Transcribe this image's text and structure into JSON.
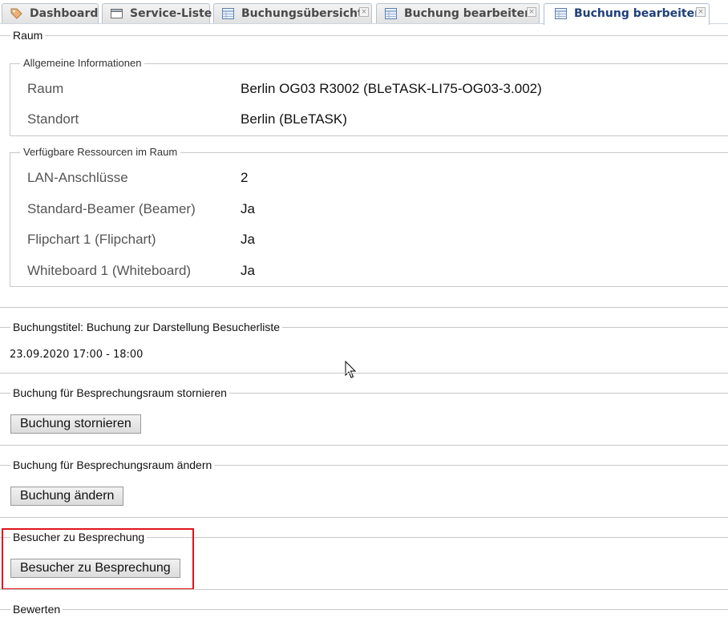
{
  "tabs": [
    {
      "label": "Dashboard",
      "icon": "tag-icon",
      "closable": false,
      "active": false
    },
    {
      "label": "Service-Liste",
      "icon": "window-icon",
      "closable": false,
      "active": false
    },
    {
      "label": "Buchungsübersicht",
      "icon": "table-icon",
      "closable": true,
      "active": false
    },
    {
      "label": "Buchung bearbeiten",
      "icon": "table-icon",
      "closable": true,
      "active": false
    },
    {
      "label": "Buchung bearbeiten",
      "icon": "table-icon",
      "closable": true,
      "active": true
    }
  ],
  "close_glyph": "×",
  "raum": {
    "title": "Raum",
    "allgemeine": {
      "title": "Allgemeine Informationen",
      "rows": [
        {
          "label": "Raum",
          "value": "Berlin OG03 R3002 (BLeTASK-LI75-OG03-3.002)"
        },
        {
          "label": "Standort",
          "value": "Berlin (BLeTASK)"
        }
      ]
    },
    "ressourcen": {
      "title": "Verfügbare Ressourcen im Raum",
      "rows": [
        {
          "label": "LAN-Anschlüsse",
          "value": "2"
        },
        {
          "label": "Standard-Beamer (Beamer)",
          "value": "Ja"
        },
        {
          "label": "Flipchart 1 (Flipchart)",
          "value": "Ja"
        },
        {
          "label": "Whiteboard 1 (Whiteboard)",
          "value": "Ja"
        }
      ]
    }
  },
  "buchungstitel": {
    "title": "Buchungstitel: Buchung zur Darstellung Besucherliste",
    "datetime": "23.09.2020 17:00 - 18:00"
  },
  "stornieren": {
    "title": "Buchung für Besprechungsraum stornieren",
    "button": "Buchung stornieren"
  },
  "aendern": {
    "title": "Buchung für Besprechungsraum ändern",
    "button": "Buchung ändern"
  },
  "besucher": {
    "title": "Besucher zu Besprechung",
    "button": "Besucher zu Besprechung"
  },
  "bewerten": {
    "title": "Bewerten"
  },
  "colors": {
    "highlight": "#e0141b",
    "active_tab_text": "#1f3f7a",
    "border": "#c8c8c8"
  }
}
